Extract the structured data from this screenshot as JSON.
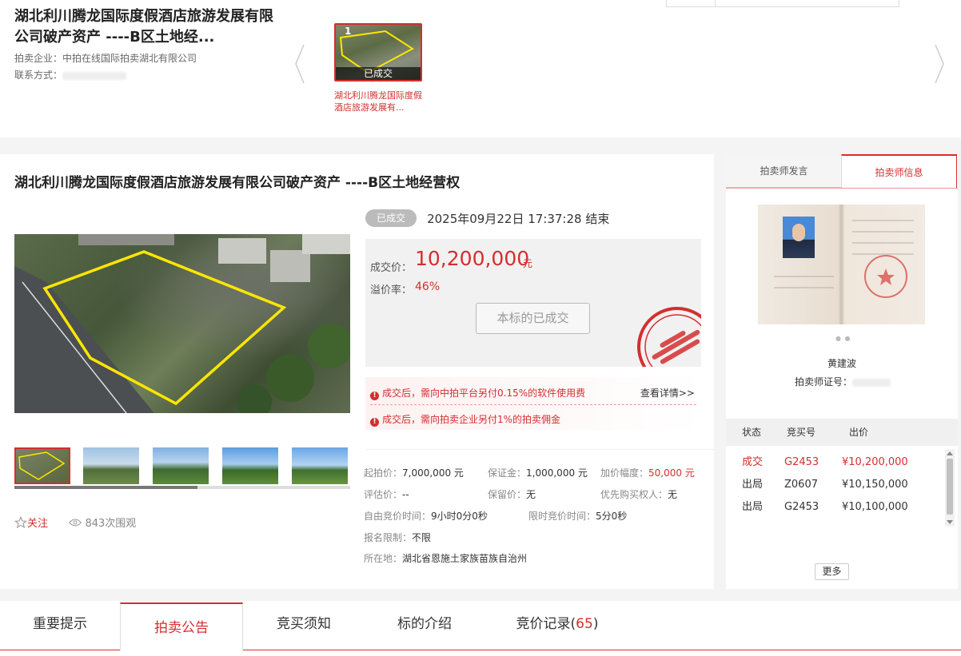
{
  "top": {
    "title": "湖北利川腾龙国际度假酒店旅游发展有限公司破产资产 ----B区土地经...",
    "company_label": "拍卖企业：",
    "company_value": "中拍在线国际拍卖湖北有限公司",
    "contact_label": "联系方式：",
    "thumb_index": "1",
    "thumb_status": "已成交",
    "thumb_caption": "湖北利川腾龙国际度假酒店旅游发展有..."
  },
  "main": {
    "title": "湖北利川腾龙国际度假酒店旅游发展有限公司破产资产 ----B区土地经营权",
    "status_badge": "已成交",
    "end_time": "2025年09月22日  17:37:28 结束",
    "deal_price_label": "成交价：",
    "deal_price": "10,200,000",
    "deal_price_unit": "元",
    "premium_label": "溢价率：",
    "premium": "46%",
    "done_button": "本标的已成交",
    "notice1": "成交后，需向中拍平台另付0.15%的软件使用费",
    "notice_more": "查看详情>>",
    "notice2": "成交后，需向拍卖企业另付1%的拍卖佣金",
    "follow": "关注",
    "views": "843次围观",
    "info": {
      "start_price_label": "起拍价：",
      "start_price": "7,000,000 元",
      "deposit_label": "保证金：",
      "deposit": "1,000,000 元",
      "increment_label": "加价幅度：",
      "increment": "50,000 元",
      "appraisal_label": "评估价：",
      "appraisal": "--",
      "reserve_label": "保留价：",
      "reserve": "无",
      "priority_label": "优先购买权人：",
      "priority": "无",
      "free_time_label": "自由竞价时间：",
      "free_time": "9小时0分0秒",
      "limited_time_label": "限时竞价时间：",
      "limited_time": "5分0秒",
      "signup_label": "报名限制：",
      "signup": "不限",
      "location_label": "所在地：",
      "location": "湖北省恩施土家族苗族自治州"
    }
  },
  "side": {
    "tab_speech": "拍卖师发言",
    "tab_info": "拍卖师信息",
    "auctioneer_name": "黄建波",
    "cert_label": "拍卖师证号：",
    "bid_header": {
      "status": "状态",
      "bidder": "竞买号",
      "price": "出价"
    },
    "bids": [
      {
        "status": "成交",
        "bidder": "G2453",
        "price": "¥10,200,000"
      },
      {
        "status": "出局",
        "bidder": "Z0607",
        "price": "¥10,150,000"
      },
      {
        "status": "出局",
        "bidder": "G2453",
        "price": "¥10,100,000"
      }
    ],
    "more": "更多"
  },
  "bottom_tabs": {
    "t1": "重要提示",
    "t2": "拍卖公告",
    "t3": "竞买须知",
    "t4": "标的介绍",
    "t5": "竞价记录(",
    "t5_count": "65",
    "t5_close": ")"
  },
  "colors": {
    "accent": "#d32f2f",
    "badge_gray": "#bbbbbb"
  }
}
